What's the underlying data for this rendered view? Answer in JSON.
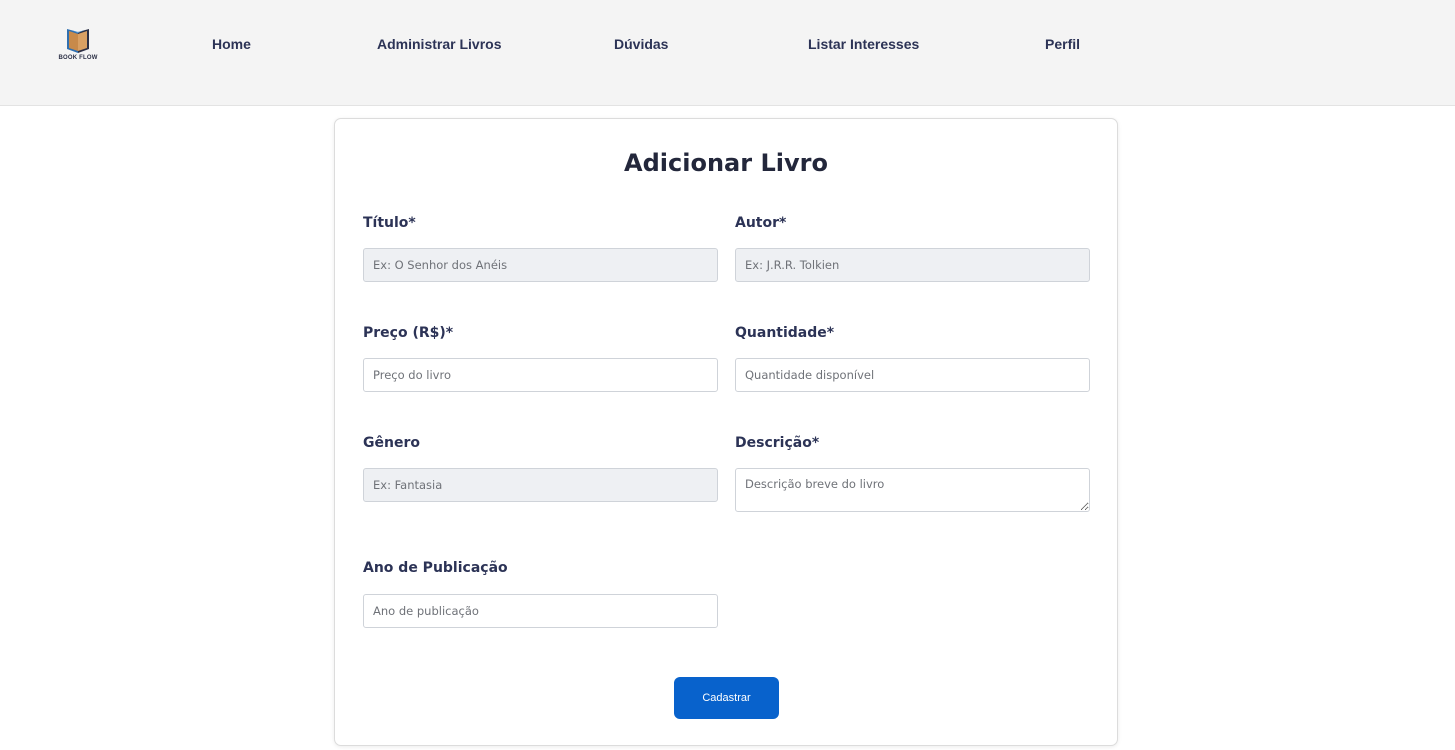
{
  "brand": {
    "logo_text": "BOOK FLOW",
    "colors": {
      "cover_blue": "#2f6fb0",
      "cover_dark": "#2b2f45",
      "pages_tan": "#c88a4a"
    }
  },
  "nav": {
    "items": [
      {
        "label": "Home"
      },
      {
        "label": "Administrar Livros"
      },
      {
        "label": "Dúvidas"
      },
      {
        "label": "Listar Interesses"
      },
      {
        "label": "Perfil"
      }
    ]
  },
  "form": {
    "title": "Adicionar Livro",
    "fields": {
      "titulo": {
        "label": "Título*",
        "placeholder": "Ex: O Senhor dos Anéis"
      },
      "autor": {
        "label": "Autor*",
        "placeholder": "Ex: J.R.R. Tolkien"
      },
      "preco": {
        "label": "Preço (R$)*",
        "placeholder": "Preço do livro"
      },
      "quantidade": {
        "label": "Quantidade*",
        "placeholder": "Quantidade disponível"
      },
      "genero": {
        "label": "Gênero",
        "placeholder": "Ex: Fantasia"
      },
      "descricao": {
        "label": "Descrição*",
        "placeholder": "Descrição breve do livro"
      },
      "ano": {
        "label": "Ano de Publicação",
        "placeholder": "Ano de publicação"
      }
    },
    "submit_label": "Cadastrar"
  },
  "colors": {
    "accent": "#0862cc",
    "label_text": "#2c3356",
    "navbar_bg": "#f4f4f4",
    "autofill_bg": "#eef0f3"
  }
}
